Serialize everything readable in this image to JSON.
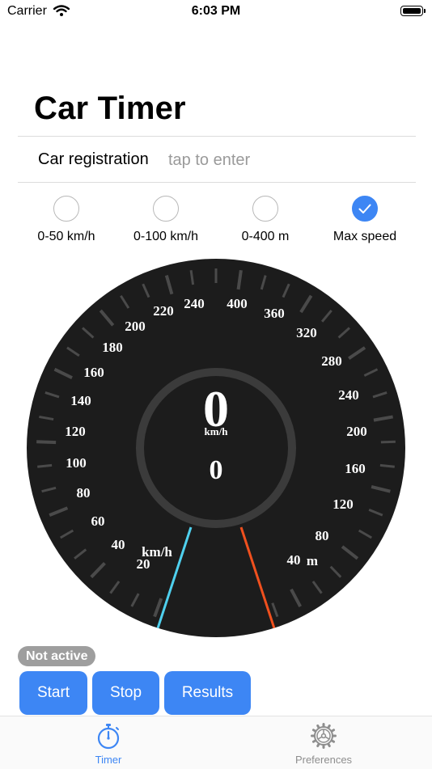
{
  "status_bar": {
    "carrier": "Carrier",
    "time": "6:03 PM"
  },
  "title": "Car Timer",
  "registration": {
    "label": "Car registration",
    "placeholder": "tap to enter"
  },
  "modes": [
    {
      "label": "0-50 km/h",
      "checked": false
    },
    {
      "label": "0-100 km/h",
      "checked": false
    },
    {
      "label": "0-400 m",
      "checked": false
    },
    {
      "label": "Max speed",
      "checked": true
    }
  ],
  "gauge": {
    "speed_value": "0",
    "speed_unit": "km/h",
    "secondary_value": "0",
    "left_unit": "km/h",
    "right_unit": "m",
    "left_scale": [
      "20",
      "40",
      "60",
      "80",
      "100",
      "120",
      "140",
      "160",
      "180",
      "200",
      "220",
      "240"
    ],
    "top_label": "400",
    "right_scale": [
      "360",
      "320",
      "280",
      "240",
      "200",
      "160",
      "120",
      "80",
      "40"
    ],
    "colors": {
      "face": "#1c1c1c",
      "ring": "#3b3b3b",
      "ticks": "#4a4a4a",
      "left_needle": "#4fd0ee",
      "right_needle": "#f0501e"
    }
  },
  "status_badge": "Not active",
  "buttons": {
    "start": "Start",
    "stop": "Stop",
    "results": "Results"
  },
  "tabs": [
    {
      "label": "Timer",
      "icon": "stopwatch-icon",
      "active": true
    },
    {
      "label": "Preferences",
      "icon": "gear-icon",
      "active": false
    }
  ],
  "accent_color": "#3d86f4"
}
